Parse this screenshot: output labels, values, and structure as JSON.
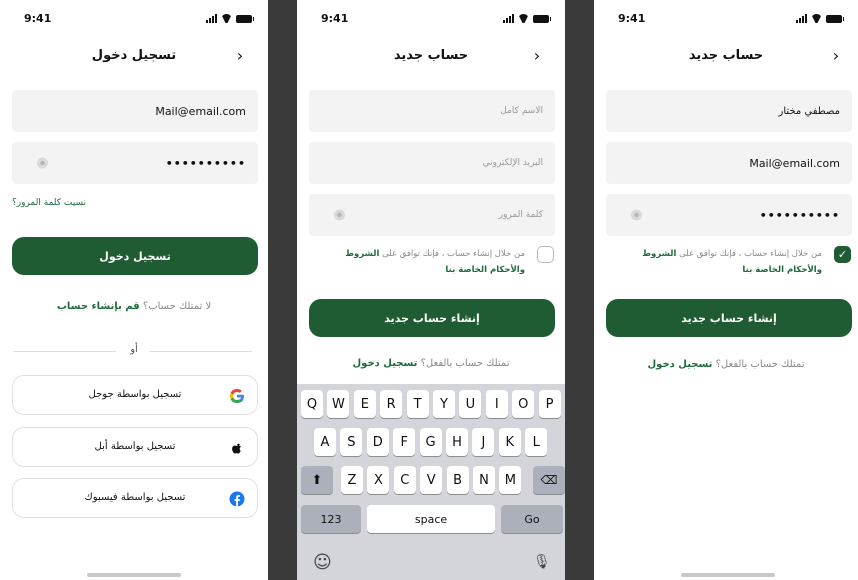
{
  "status_time": "9:41",
  "login": {
    "title": "تسجيل دخول",
    "email_value": "Mail@email.com",
    "password_mask": "••••••••••",
    "forgot_password": "نسيت كلمة المرور؟",
    "login_button": "تسجيل دخول",
    "no_account_text": "لا تمتلك حساب؟",
    "create_account_link": "قم بإنشاء حساب",
    "or_label": "أو",
    "social": [
      {
        "label": "تسجيل بواسطة جوجل",
        "icon": "google-icon"
      },
      {
        "label": "تسجيل بواسطة أبل",
        "icon": "apple-icon"
      },
      {
        "label": "تسجيل بواسطة فيسبوك",
        "icon": "facebook-icon"
      }
    ]
  },
  "signup_empty": {
    "title": "حساب جديد",
    "name_placeholder": "الاسم كامل",
    "email_placeholder": "البريد الإلكتروني",
    "password_placeholder": "كلمة المرور",
    "terms_prefix": "من خلال إنشاء حساب ، فإنك توافق على",
    "terms_link1": "الشروط",
    "terms_link2": "والأحكام الخاصة بنا",
    "create_button": "إنشاء حساب جديد",
    "have_account_text": "تمتلك حساب بالفعل؟",
    "login_link": "تسجيل دخول"
  },
  "signup_filled": {
    "title": "حساب جديد",
    "name_value": "مصطفي مختار",
    "email_value": "Mail@email.com",
    "password_mask": "••••••••••",
    "terms_prefix": "من خلال إنشاء حساب ، فإنك توافق على",
    "terms_link1": "الشروط",
    "terms_link2": "والأحكام الخاصة بنا",
    "create_button": "إنشاء حساب جديد",
    "have_account_text": "تمتلك حساب بالفعل؟",
    "login_link": "تسجيل دخول",
    "checkmark": "✓"
  },
  "keyboard": {
    "row1": [
      "Q",
      "W",
      "E",
      "R",
      "T",
      "Y",
      "U",
      "I",
      "O",
      "P"
    ],
    "row2": [
      "A",
      "S",
      "D",
      "F",
      "G",
      "H",
      "J",
      "K",
      "L"
    ],
    "row3": [
      "Z",
      "X",
      "C",
      "V",
      "B",
      "N",
      "M"
    ],
    "shift": "⬆",
    "delete": "⌫",
    "numbers": "123",
    "space": "space",
    "go": "Go",
    "emoji": "☺",
    "mic": "🎙"
  },
  "colors": {
    "primary": "#1f5c33",
    "link": "#1f6b3b"
  }
}
